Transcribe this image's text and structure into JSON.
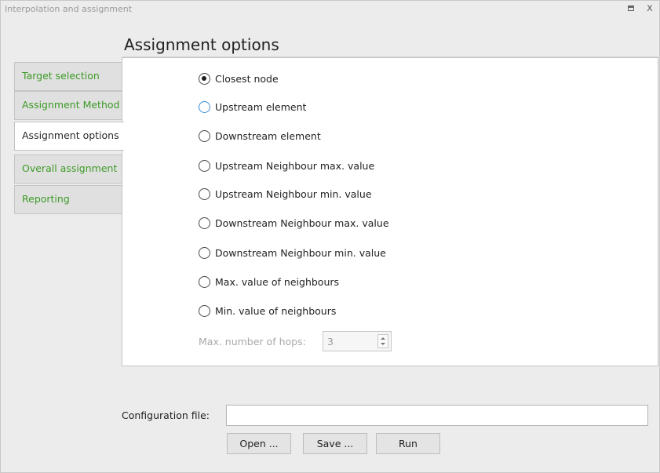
{
  "window": {
    "title": "Interpolation and assignment",
    "close_glyph": "x",
    "icons": [
      "maximize-icon",
      "close-icon"
    ]
  },
  "section_title": "Assignment options",
  "sidebar": {
    "items": [
      {
        "label": "Target selection",
        "active": false
      },
      {
        "label": "Assignment Method",
        "active": false
      },
      {
        "label": "Assignment options",
        "active": true
      },
      {
        "label": "Overall assignment",
        "active": false
      },
      {
        "label": "Reporting",
        "active": false
      }
    ]
  },
  "options": {
    "selected": "Closest node",
    "items": [
      {
        "label": "Closest node",
        "checked": true
      },
      {
        "label": "Upstream element",
        "checked": false
      },
      {
        "label": "Downstream element",
        "checked": false
      },
      {
        "label": "Upstream Neighbour max. value",
        "checked": false
      },
      {
        "label": "Upstream Neighbour min. value",
        "checked": false
      },
      {
        "label": "Downstream Neighbour max. value",
        "checked": false
      },
      {
        "label": "Downstream Neighbour min. value",
        "checked": false
      },
      {
        "label": "Max. value of neighbours",
        "checked": false
      },
      {
        "label": "Min. value of neighbours",
        "checked": false
      }
    ],
    "max_hops": {
      "label": "Max. number of hops:",
      "value": "3",
      "enabled": false
    }
  },
  "config": {
    "label": "Configuration file:",
    "value": "",
    "buttons": {
      "open": "Open ...",
      "save": "Save ...",
      "run": "Run"
    }
  },
  "colors": {
    "tab_text": "#3c9a26",
    "radio_hover": "#3a8fd6",
    "disabled_text": "#a8a8a8"
  }
}
